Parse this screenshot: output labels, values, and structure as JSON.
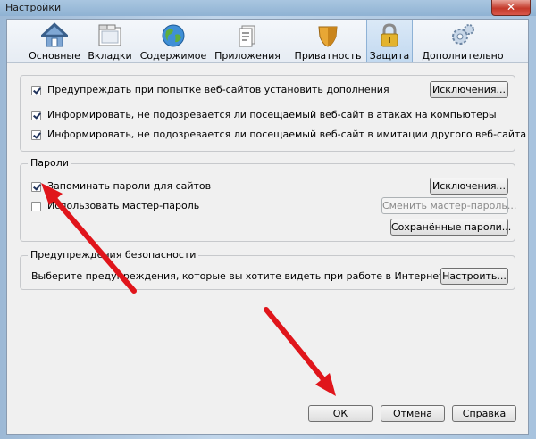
{
  "window": {
    "title": "Настройки",
    "close_glyph": "✕"
  },
  "tabs": [
    {
      "label": "Основные",
      "icon": "house-icon"
    },
    {
      "label": "Вкладки",
      "icon": "tabs-icon"
    },
    {
      "label": "Содержимое",
      "icon": "globe-icon"
    },
    {
      "label": "Приложения",
      "icon": "applications-icon"
    },
    {
      "label": "Приватность",
      "icon": "privacy-mask-icon"
    },
    {
      "label": "Защита",
      "icon": "padlock-icon",
      "active": true
    },
    {
      "label": "Дополнительно",
      "icon": "gears-icon"
    }
  ],
  "security": {
    "warn_addons": {
      "label": "Предупреждать при попытке веб-сайтов установить дополнения",
      "checked": true
    },
    "exceptions_label": "Исключения...",
    "report_attack": {
      "label": "Информировать, не подозревается ли посещаемый веб-сайт в атаках на компьютеры",
      "checked": true
    },
    "report_forgery": {
      "label": "Информировать, не подозревается ли посещаемый веб-сайт в имитации другого веб-сайта",
      "checked": true
    }
  },
  "passwords": {
    "legend": "Пароли",
    "remember": {
      "label": "Запоминать пароли для сайтов",
      "checked": true
    },
    "exceptions_label": "Исключения...",
    "master": {
      "label": "Использовать мастер-пароль",
      "checked": false
    },
    "change_master_label": "Сменить мастер-пароль...",
    "saved_label": "Сохранённые пароли..."
  },
  "warnings": {
    "legend": "Предупреждения безопасности",
    "text": "Выберите предупреждения, которые вы хотите видеть при работе в Интернете",
    "configure_label": "Настроить..."
  },
  "footer": {
    "ok": "ОК",
    "cancel": "Отмена",
    "help": "Справка"
  },
  "colors": {
    "arrow": "#e0151b"
  }
}
